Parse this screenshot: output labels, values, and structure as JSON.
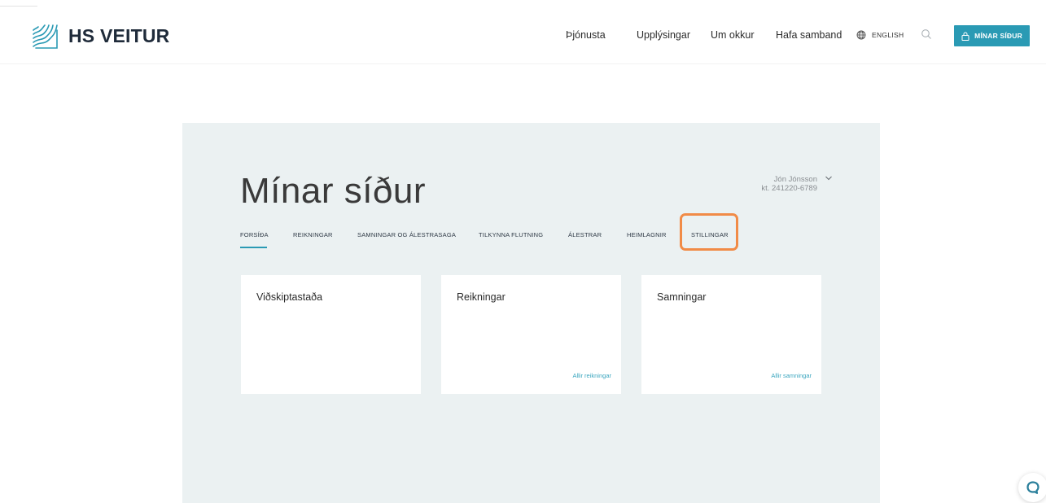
{
  "header": {
    "logo_text": "HS VEITUR",
    "nav": [
      {
        "label": "Þjónusta"
      },
      {
        "label": "Upplýsingar"
      },
      {
        "label": "Um okkur"
      },
      {
        "label": "Hafa samband"
      }
    ],
    "language_label": "ENGLISH",
    "my_pages_button": "MÍNAR SÍÐUR",
    "icons": {
      "logo": "waves-logo-icon",
      "language": "globe-icon",
      "search": "search-icon",
      "lock": "lock-icon"
    }
  },
  "main": {
    "title": "Mínar síður",
    "user": {
      "name": "Jón Jónsson",
      "id_line": "kt. 241220-6789"
    },
    "tabs": [
      {
        "label": "FORSÍÐA",
        "active": true
      },
      {
        "label": "REIKNINGAR"
      },
      {
        "label": "SAMNINGAR OG ÁLESTRASAGA"
      },
      {
        "label": "TILKYNNA FLUTNING"
      },
      {
        "label": "ÁLESTRAR"
      },
      {
        "label": "HEIMLAGNIR"
      },
      {
        "label": "STILLINGAR",
        "highlighted": true
      }
    ],
    "cards": [
      {
        "title": "Viðskiptastaða",
        "link": ""
      },
      {
        "title": "Reikningar",
        "link": "Allir reikningar"
      },
      {
        "title": "Samningar",
        "link": "Allir samningar"
      }
    ]
  },
  "colors": {
    "accent": "#2a9ab4",
    "panel_bg": "#ebf1f2",
    "highlight": "#f18b47",
    "link": "#3ba6bf"
  }
}
